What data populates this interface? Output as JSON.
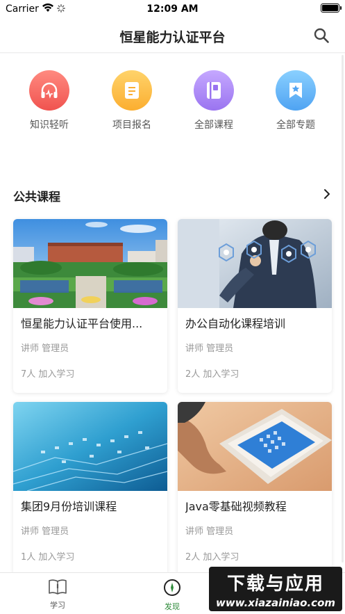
{
  "status_bar": {
    "carrier": "Carrier",
    "time": "12:09 AM"
  },
  "nav": {
    "title": "恒星能力认证平台"
  },
  "quick_actions": [
    {
      "label": "知识轻听",
      "icon": "headphones-icon",
      "color_top": "#ff8a80",
      "color_bottom": "#f0534f"
    },
    {
      "label": "项目报名",
      "icon": "document-icon",
      "color_top": "#ffd36b",
      "color_bottom": "#fbae30"
    },
    {
      "label": "全部课程",
      "icon": "book-icon",
      "color_top": "#c5a8ff",
      "color_bottom": "#9a74f0"
    },
    {
      "label": "全部专题",
      "icon": "star-bookmark-icon",
      "color_top": "#8ad0ff",
      "color_bottom": "#4fa3f2"
    }
  ],
  "section": {
    "title": "公共课程"
  },
  "courses": [
    {
      "title": "恒星能力认证平台使用...",
      "lecturer": "讲师 管理员",
      "joined": "7人 加入学习"
    },
    {
      "title": "办公自动化课程培训",
      "lecturer": "讲师 管理员",
      "joined": "2人 加入学习"
    },
    {
      "title": "集团9月份培训课程",
      "lecturer": "讲师 管理员",
      "joined": "1人 加入学习"
    },
    {
      "title": "Java零基础视频教程",
      "lecturer": "讲师 管理员",
      "joined": "2人 加入学习"
    }
  ],
  "tabs": [
    {
      "label": "学习",
      "active": false
    },
    {
      "label": "发现",
      "active": true
    }
  ],
  "colors": {
    "active_tab": "#2e8b3a",
    "inactive_tab": "#555555"
  },
  "watermark": {
    "line1": "下载与应用",
    "line2": "www.xiazainiao.com"
  }
}
